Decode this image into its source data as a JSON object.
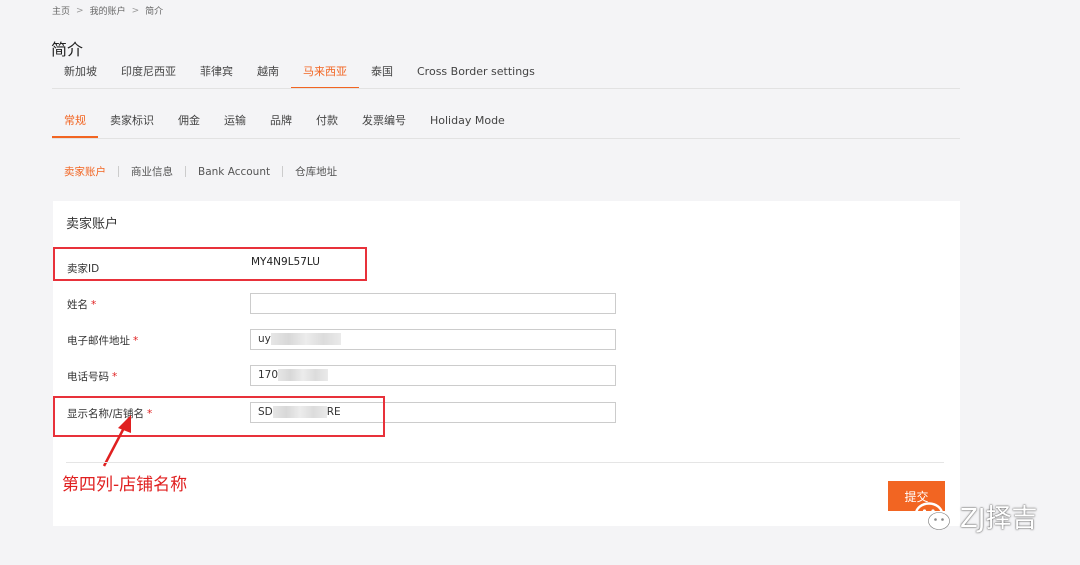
{
  "breadcrumb": {
    "home": "主页",
    "sep": ">",
    "account": "我的账户",
    "current": "简介"
  },
  "page_title": "简介",
  "country_tabs": [
    {
      "label": "新加坡",
      "active": false
    },
    {
      "label": "印度尼西亚",
      "active": false
    },
    {
      "label": "菲律宾",
      "active": false
    },
    {
      "label": "越南",
      "active": false
    },
    {
      "label": "马来西亚",
      "active": true
    },
    {
      "label": "泰国",
      "active": false
    },
    {
      "label": "Cross Border settings",
      "active": false
    }
  ],
  "main_tabs": [
    {
      "label": "常规",
      "active": true
    },
    {
      "label": "卖家标识",
      "active": false
    },
    {
      "label": "佣金",
      "active": false
    },
    {
      "label": "运输",
      "active": false
    },
    {
      "label": "品牌",
      "active": false
    },
    {
      "label": "付款",
      "active": false
    },
    {
      "label": "发票编号",
      "active": false
    },
    {
      "label": "Holiday Mode",
      "active": false
    }
  ],
  "sub_tabs": [
    {
      "label": "卖家账户",
      "active": true
    },
    {
      "label": "商业信息",
      "active": false
    },
    {
      "label": "Bank Account",
      "active": false
    },
    {
      "label": "仓库地址",
      "active": false
    }
  ],
  "form": {
    "title": "卖家账户",
    "seller_id_label": "卖家ID",
    "seller_id_value": "MY4N9L57LU",
    "name_label": "姓名",
    "name_value": "",
    "email_label": "电子邮件地址",
    "email_value_prefix": "uy",
    "phone_label": "电话号码",
    "phone_value_prefix": "170",
    "display_name_label": "显示名称/店铺名",
    "display_name_prefix": "SD",
    "display_name_suffix": "RE",
    "required_mark": "*",
    "submit_label": "提交"
  },
  "annotation": "第四列-店铺名称",
  "watermark": "ZJ择吉",
  "colors": {
    "accent": "#f26522",
    "highlight": "#e8313a"
  }
}
